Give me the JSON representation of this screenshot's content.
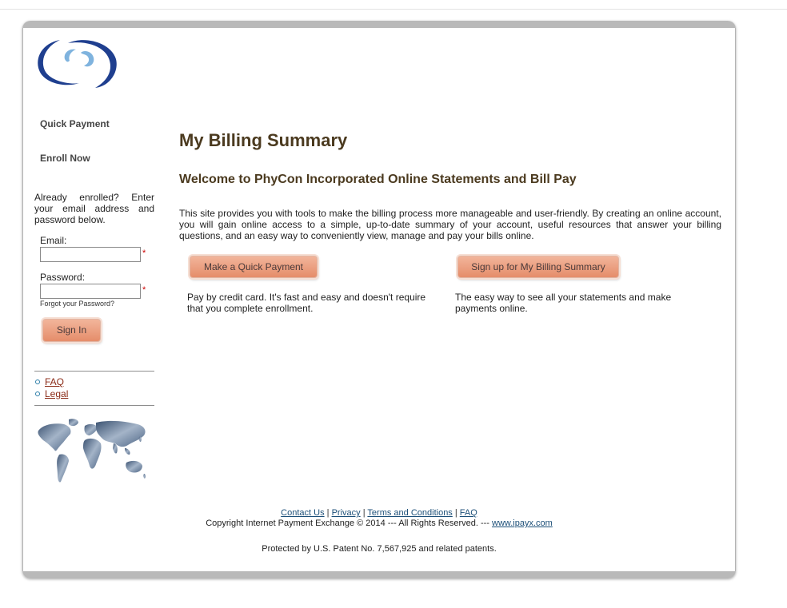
{
  "sidebar": {
    "nav": {
      "quick_payment": "Quick Payment",
      "enroll_now": "Enroll Now"
    },
    "login": {
      "intro": "Already enrolled? Enter your email address and password below.",
      "email_label": "Email:",
      "email_value": "",
      "password_label": "Password:",
      "password_value": "",
      "required_mark": "*",
      "forgot_password": "Forgot your Password?",
      "sign_in": "Sign In"
    },
    "links": {
      "faq": "FAQ",
      "legal": "Legal"
    }
  },
  "main": {
    "title": "My Billing Summary",
    "welcome": "Welcome to PhyCon Incorporated Online Statements and Bill Pay",
    "description": "This site provides you with tools to make the billing process more manageable and user-friendly. By creating an online account, you will gain online access to a simple, up-to-date summary of your account, useful resources that answer your billing questions, and an easy way to conveniently view, manage and pay your bills online.",
    "quick_payment": {
      "button": "Make a Quick Payment",
      "text": "Pay by credit card. It's fast and easy and doesn't require that you complete enrollment."
    },
    "signup": {
      "button": "Sign up for My Billing Summary",
      "text": "The easy way to see all your statements and make payments online."
    }
  },
  "footer": {
    "contact": "Contact Us",
    "privacy": "Privacy",
    "terms": "Terms and Conditions",
    "faq": "FAQ",
    "separator": " | ",
    "copyright": "Copyright Internet Payment Exchange © 2014 --- All Rights Reserved. --- ",
    "website": "www.ipayx.com",
    "patent": "Protected by U.S. Patent No. 7,567,925 and related patents."
  },
  "colors": {
    "heading": "#4b3a1f",
    "button_top": "#f2b59b",
    "button_bottom": "#e58d6a",
    "link_red": "#8b2a16",
    "link_blue": "#1c4f78",
    "logo_blue": "#1f3f8f",
    "frame_gray": "#b9b9b9"
  },
  "icons": {
    "logo": "swirl-logo-icon",
    "map": "world-map-icon",
    "bullet": "circle-bullet-icon"
  }
}
